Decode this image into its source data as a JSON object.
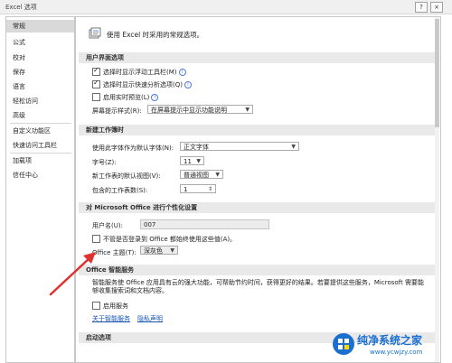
{
  "window": {
    "title": "Excel 选项",
    "help_label": "?",
    "close_label": "×"
  },
  "sidebar": {
    "items": [
      {
        "label": "常规"
      },
      {
        "label": "公式"
      },
      {
        "label": "校对"
      },
      {
        "label": "保存"
      },
      {
        "label": "语言"
      },
      {
        "label": "轻松访问"
      },
      {
        "label": "高级"
      },
      {
        "label": "自定义功能区"
      },
      {
        "label": "快速访问工具栏"
      },
      {
        "label": "加载项"
      },
      {
        "label": "信任中心"
      }
    ]
  },
  "main": {
    "intro": "使用 Excel 时采用的常规选项。",
    "ui_section": {
      "title": "用户界面选项",
      "mini_toolbar": "选择时显示浮动工具栏(M)",
      "quick_analysis": "选择时显示快速分析选项(Q)",
      "live_preview": "启用实时预览(L)",
      "tooltip_label": "屏幕提示样式(R):",
      "tooltip_value": "在屏幕提示中显示功能说明"
    },
    "new_workbook": {
      "title": "新建工作簿时",
      "font_label": "使用此字体作为默认字体(N):",
      "font_value": "正文字体",
      "size_label": "字号(Z):",
      "size_value": "11",
      "view_label": "新工作表的默认视图(V):",
      "view_value": "普通视图",
      "sheets_label": "包含的工作表数(S):",
      "sheets_value": "1"
    },
    "personalize": {
      "title": "对 Microsoft Office 进行个性化设置",
      "username_label": "用户名(U):",
      "username_value": "007",
      "always_use": "不管是否登录到 Office 都始终使用这些值(A)。",
      "theme_label": "Office 主题(T):",
      "theme_value": "深灰色"
    },
    "smart": {
      "title": "Office 智能服务",
      "description": "智能服务使 Office 应用具有云的强大功能，可帮助节约时间，获得更好的结果。若要提供这些服务，Microsoft 需要能够收集搜索词和文档内容。",
      "enable": "启用服务",
      "about_link": "关于智能服务",
      "privacy_link": "隐私声明"
    },
    "startup": {
      "title": "启动选项"
    }
  },
  "watermark": {
    "text": "纯净系统之家",
    "url": "www.ycwjzy.com"
  },
  "colors": {
    "arrow": "#e0312f",
    "link": "#1a55b5",
    "watermark": "#1b6fcf"
  }
}
